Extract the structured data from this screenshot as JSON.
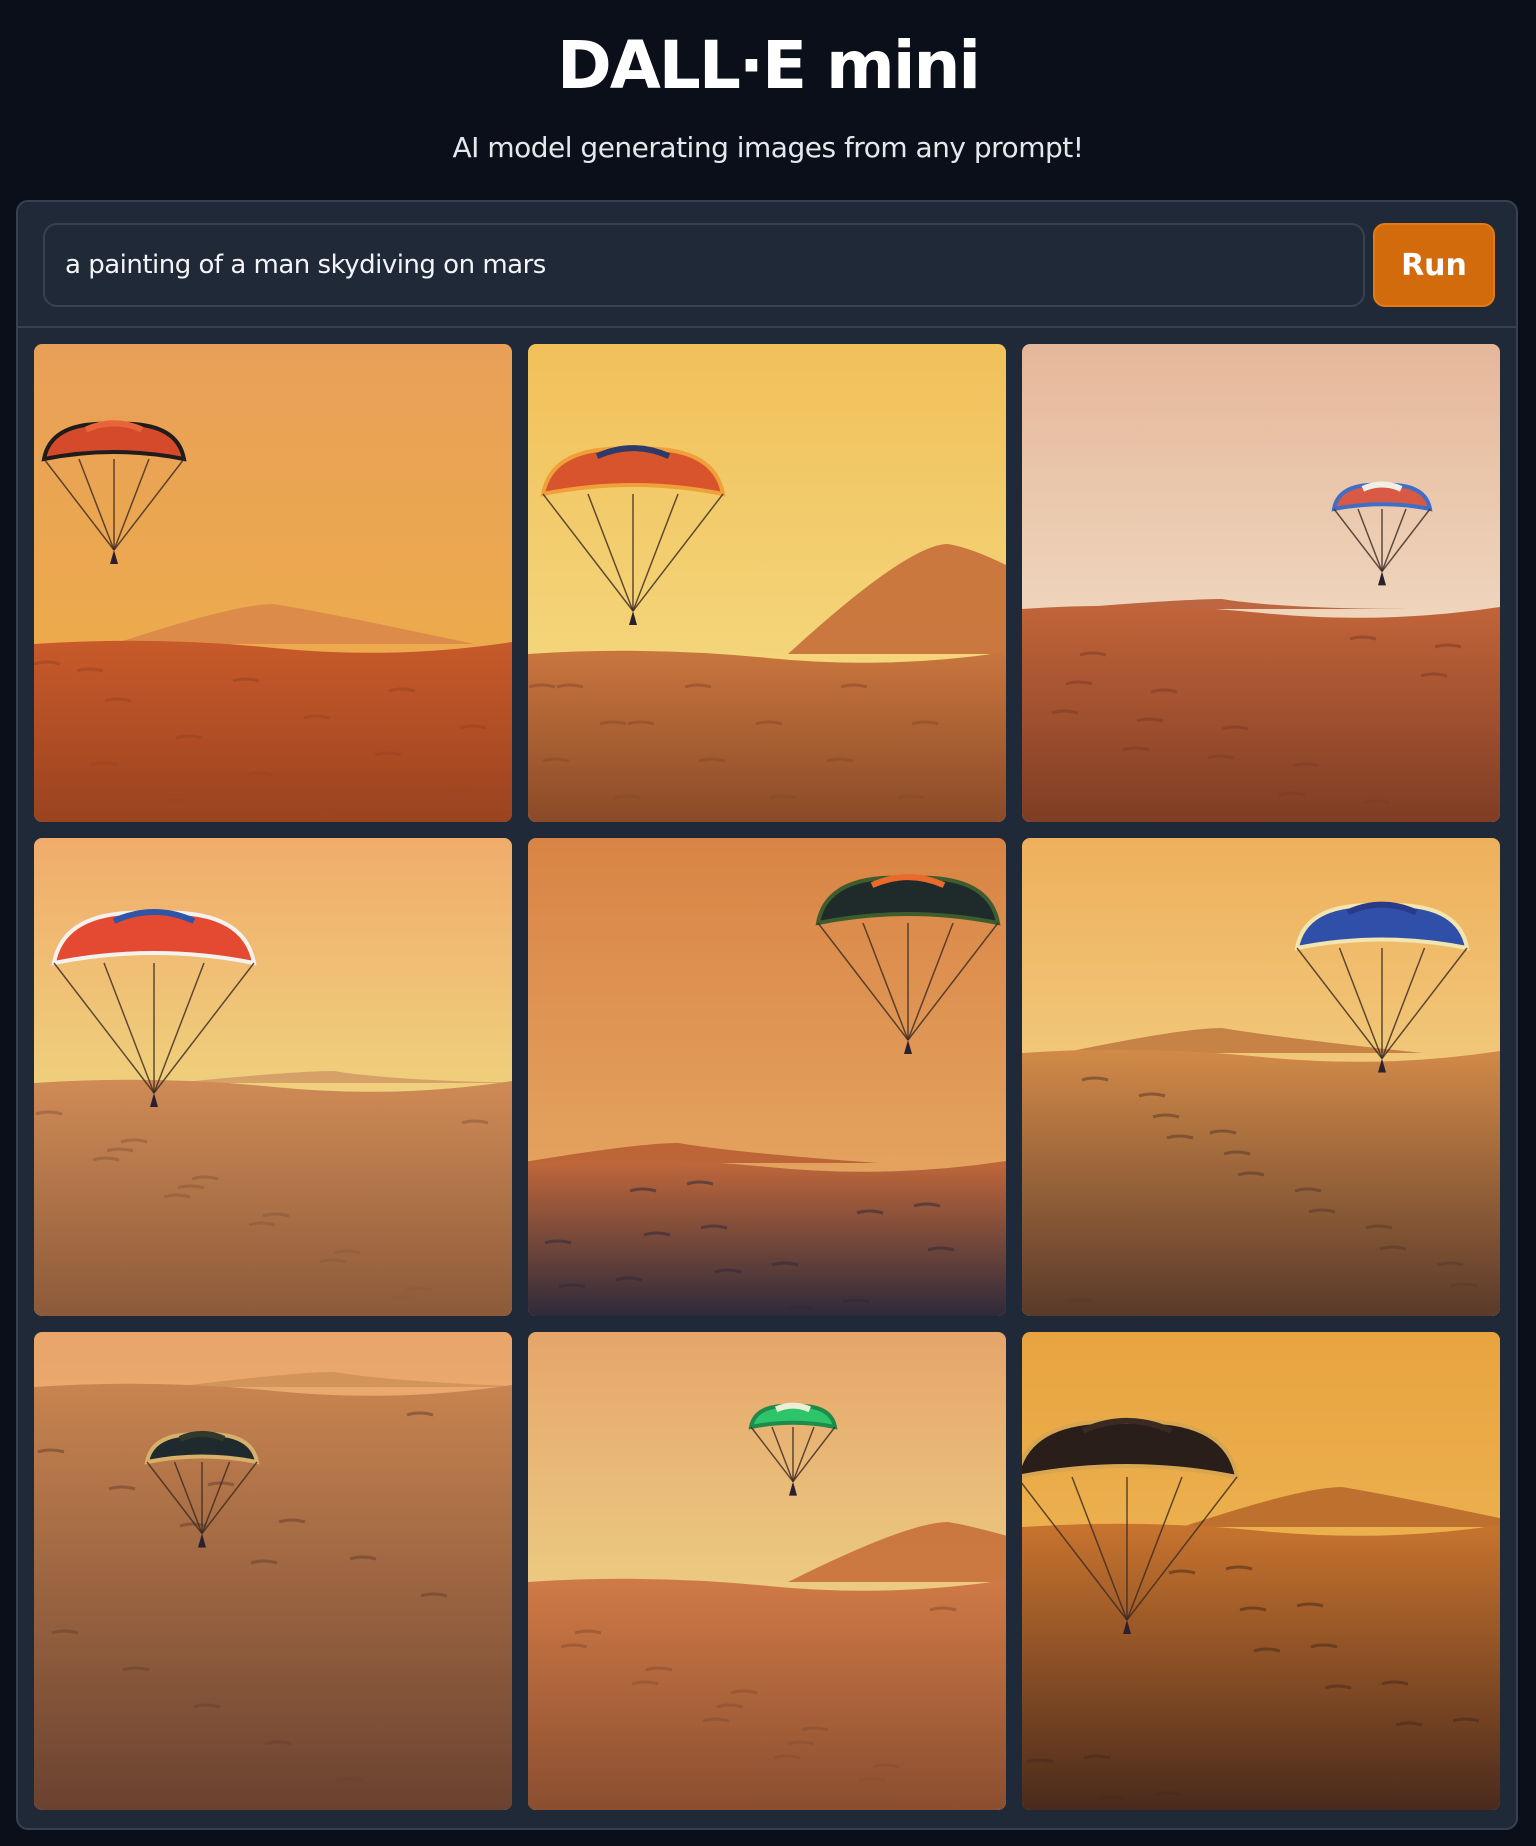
{
  "header": {
    "title": "DALL·E mini",
    "subtitle": "AI model generating images from any prompt!"
  },
  "prompt": {
    "value": "a painting of a man skydiving on mars"
  },
  "run_button": {
    "label": "Run"
  },
  "colors": {
    "background": "#0b0f19",
    "panel": "#1f2937",
    "border": "#374151",
    "accent": "#d26b0b"
  },
  "gallery": {
    "items": [
      {
        "sky_top": "#e8a058",
        "sky_bottom": "#f0b046",
        "ground": "#c85a2a",
        "ground_dark": "#9a4320",
        "canopy": [
          "#d44a2a",
          "#1f1c1c",
          "#e8643a"
        ],
        "hill": "#d9874a"
      },
      {
        "sky_top": "#f1c05a",
        "sky_bottom": "#f5e08a",
        "ground": "#c9763e",
        "ground_dark": "#8a4a28",
        "canopy": [
          "#d8542c",
          "#f0a038",
          "#2f3a6a"
        ],
        "hill": "#c66e3a"
      },
      {
        "sky_top": "#e6b79a",
        "sky_bottom": "#f4ecd6",
        "ground": "#c2643a",
        "ground_dark": "#7f3d24",
        "canopy": [
          "#d85a44",
          "#3f6ec6",
          "#f2efe6"
        ],
        "hill": "#b85a34"
      },
      {
        "sky_top": "#f0ac6c",
        "sky_bottom": "#eef08a",
        "ground": "#d08b56",
        "ground_dark": "#8c5a3a",
        "canopy": [
          "#e44a32",
          "#f4f2ee",
          "#2f55a6"
        ],
        "hill": "#d39c66"
      },
      {
        "sky_top": "#d98445",
        "sky_bottom": "#e8b06a",
        "ground": "#c1683a",
        "ground_dark": "#2f2a3a",
        "canopy": [
          "#1f2a2a",
          "#3f5c2e",
          "#e96a2a"
        ],
        "hill": "#b85e32"
      },
      {
        "sky_top": "#eeb05c",
        "sky_bottom": "#f4e29a",
        "ground": "#d28a48",
        "ground_dark": "#5a3a2a",
        "canopy": [
          "#2f4fa8",
          "#f2e6b0",
          "#2a3a8a"
        ],
        "hill": "#c27a40"
      },
      {
        "sky_top": "#e9a56a",
        "sky_bottom": "#edbd84",
        "ground": "#c88450",
        "ground_dark": "#6a4230",
        "canopy": [
          "#1f2a2e",
          "#d8b06a",
          "#2f3a2a"
        ],
        "hill": "#d09258"
      },
      {
        "sky_top": "#e6a56a",
        "sky_bottom": "#f0ea96",
        "ground": "#d07a46",
        "ground_dark": "#8a4e30",
        "canopy": [
          "#2ec46a",
          "#1f8a4a",
          "#eaf0d6"
        ],
        "hill": "#c8703a"
      },
      {
        "sky_top": "#e8a440",
        "sky_bottom": "#f0c060",
        "ground": "#c8742e",
        "ground_dark": "#4a2a1c",
        "canopy": [
          "#2a1e1a",
          "#d8a650",
          "#3a2a22"
        ],
        "hill": "#b96a2c"
      }
    ]
  }
}
